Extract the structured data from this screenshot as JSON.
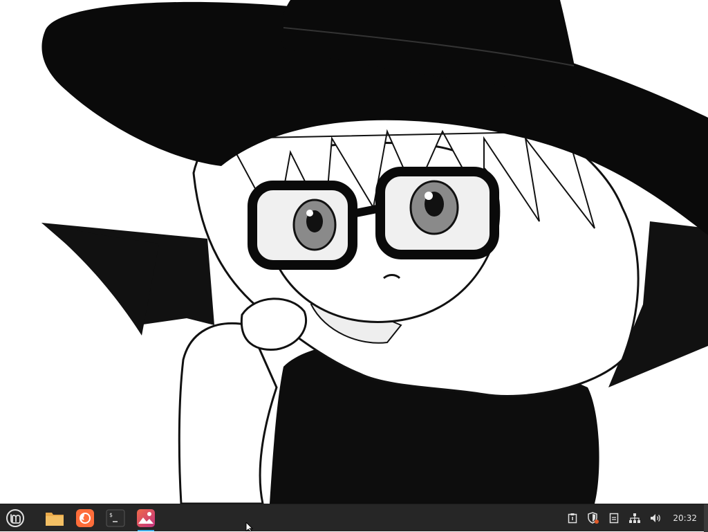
{
  "desktop": {
    "wallpaper": "monochrome-anime-witch-girl-illustration"
  },
  "taskbar": {
    "background_color": "#262626",
    "menu_icon": "linux-mint-logo-icon",
    "launchers": [
      {
        "name": "file-manager",
        "icon": "folder-icon",
        "color": "#e9a94a"
      },
      {
        "name": "firefox",
        "icon": "firefox-icon",
        "color": "#ff6d3a"
      },
      {
        "name": "terminal",
        "icon": "terminal-icon",
        "color": "#2b2b2b"
      },
      {
        "name": "image-viewer",
        "icon": "image-viewer-icon",
        "color": "#d84a7b",
        "active": true
      }
    ],
    "tray": {
      "icons": [
        "clipboard-icon",
        "update-shield-icon",
        "notes-icon",
        "network-icon",
        "volume-icon"
      ],
      "clock": "20:32"
    },
    "accent_color": "#3daee9"
  }
}
